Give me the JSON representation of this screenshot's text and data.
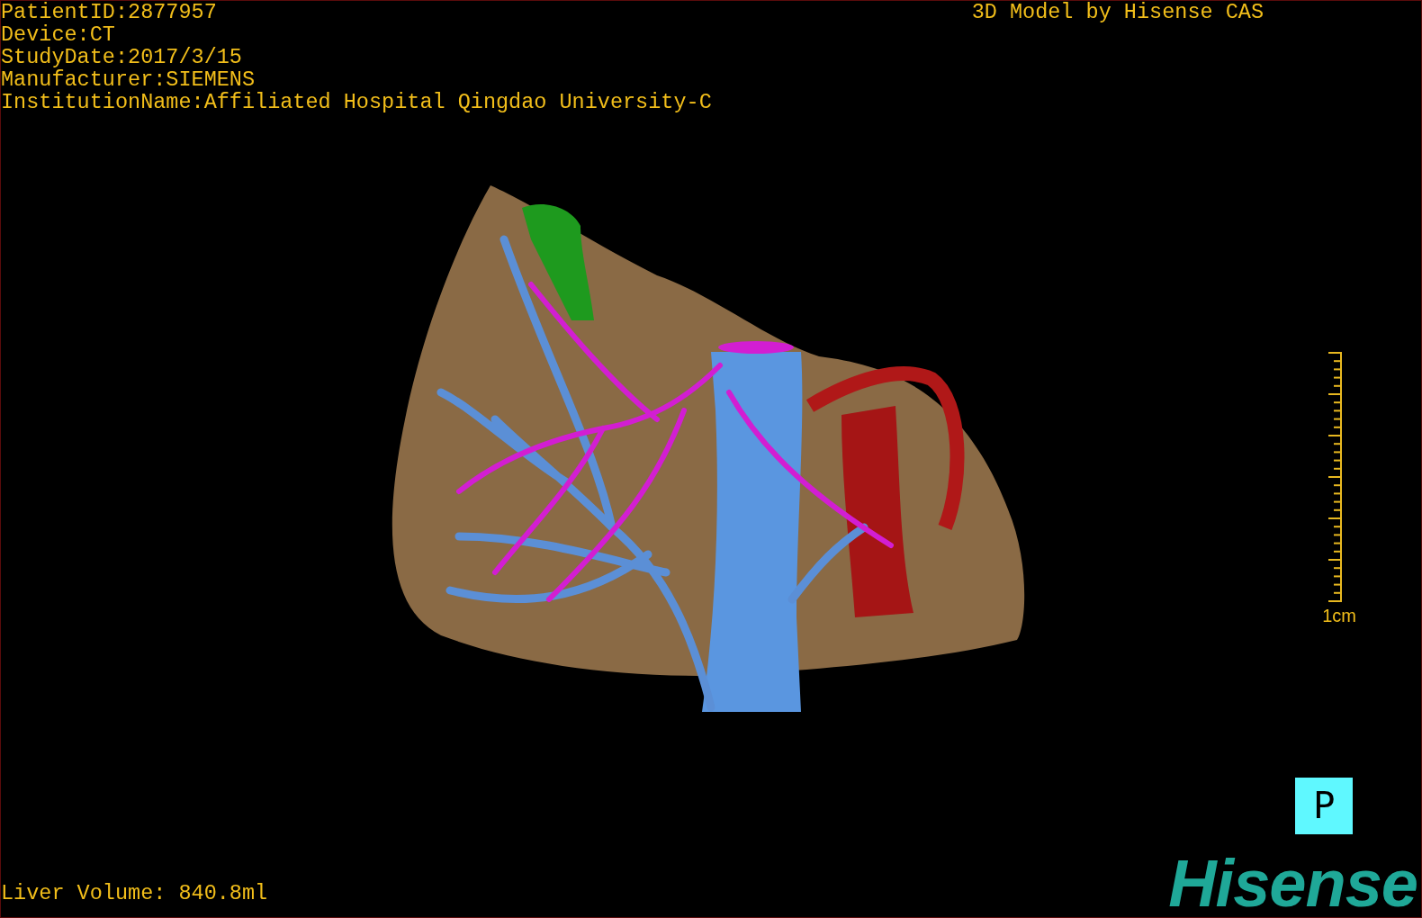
{
  "patient_info": [
    "PatientID:2877957",
    "Device:CT",
    "StudyDate:2017/3/15",
    "Manufacturer:SIEMENS",
    "InstitutionName:Affiliated Hospital Qingdao University-C"
  ],
  "title": "3D Model by Hisense CAS",
  "scale_bar": {
    "label": "1cm"
  },
  "liver_volume": "Liver Volume: 840.8ml",
  "orientation_marker": "P",
  "logo": "Hisense"
}
